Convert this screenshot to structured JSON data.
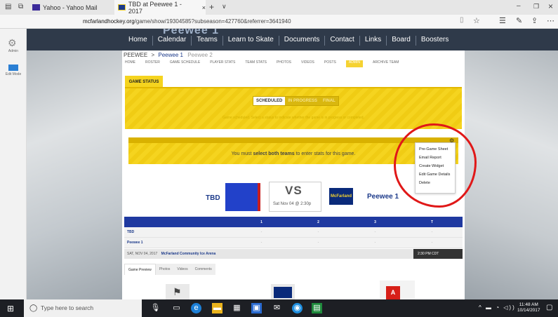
{
  "browser": {
    "tabs": [
      {
        "title": "Yahoo - Yahoo Mail"
      },
      {
        "title": "TBD at Peewee 1 - 2017"
      }
    ],
    "new_tab": "+",
    "tab_menu": "∨",
    "address": {
      "domain": "mcfarlandhockey.org",
      "path": "/game/show/19304585?subseason=427760&referrer=3641940"
    },
    "window_controls": {
      "minimize": "–",
      "restore": "❐",
      "close": "×"
    }
  },
  "admin_sidebar": {
    "items": [
      {
        "label": "Admin",
        "icon": "gear-icon"
      },
      {
        "label": "Edit Mode",
        "icon": "edit-mode-icon"
      }
    ]
  },
  "site_nav": {
    "logo_text": "Peewee 1",
    "links": [
      "Home",
      "Calendar",
      "Teams",
      "Learn to Skate",
      "Documents",
      "Contact",
      "Links",
      "Board",
      "Boosters"
    ]
  },
  "breadcrumb": {
    "root": "PEEWEE",
    "sep": ">",
    "current": "Peewee 1",
    "extra": "Peewee 2"
  },
  "sub_nav": [
    "HOME",
    "ROSTER",
    "GAME SCHEDULE",
    "PLAYER STATS",
    "TEAM STATS",
    "PHOTOS",
    "VIDEOS",
    "POSTS",
    "ADMIN",
    "ARCHIVE TEAM"
  ],
  "game_status": {
    "tab_label": "GAME STATUS",
    "buttons": [
      "SCHEDULED",
      "IN PROGRESS",
      "FINAL"
    ],
    "note": "Game scheduled. Select a status to indicate whether the game is in progress or completed."
  },
  "stats": {
    "message_pre": "You must ",
    "message_bold": "select both teams",
    "message_post": " to enter stats for this game."
  },
  "dropdown": {
    "items": [
      "Pre-Game Sheet",
      "Email Report",
      "Create Widget",
      "Edit Game Details",
      "Delete"
    ]
  },
  "matchup": {
    "away": "TBD",
    "vs": "VS",
    "date": "Sat Nov 04 @ 2:30p",
    "home": "Peewee 1",
    "home_logo_text": "McFarland"
  },
  "score_table": {
    "headers": [
      "",
      "1",
      "2",
      "3",
      "T"
    ],
    "rows": [
      {
        "team": "TBD",
        "cells": [
          "-",
          "-",
          "-",
          "-"
        ]
      },
      {
        "team": "Peewee 1",
        "cells": [
          "-",
          "-",
          "-",
          "-"
        ]
      }
    ]
  },
  "game_info": {
    "date": "SAT, NOV 04, 2017",
    "venue": "McFarland Community Ice Arena",
    "time": "2:30 PM CDT"
  },
  "preview_tabs": [
    "Game Preview",
    "Photos",
    "Videos",
    "Comments"
  ],
  "taskbar": {
    "search_placeholder": "Type here to search",
    "time": "11:48 AM",
    "date": "10/14/2017"
  }
}
